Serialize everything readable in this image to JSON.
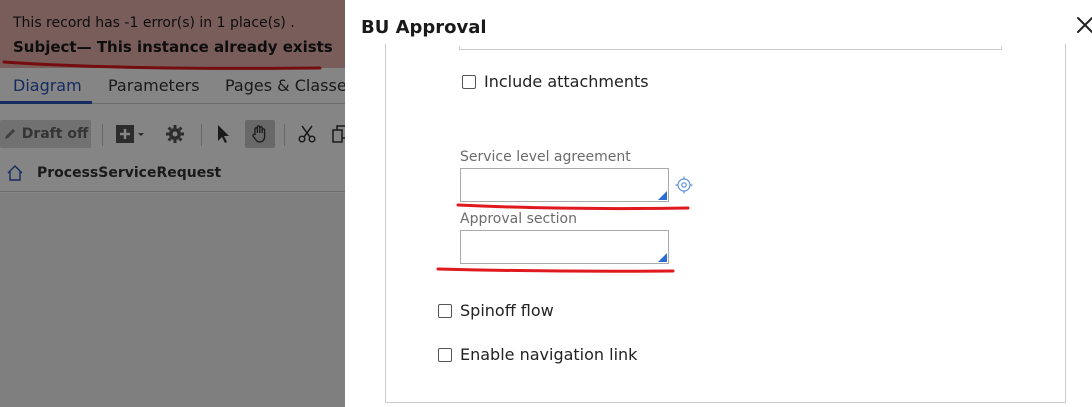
{
  "background": {
    "error_banner": {
      "line1": "This record has -1 error(s) in 1 place(s) .",
      "line2": "Subject— This instance already exists"
    },
    "tabs": [
      {
        "label": "Diagram",
        "active": true
      },
      {
        "label": "Parameters",
        "active": false
      },
      {
        "label": "Pages & Classes",
        "active": false
      }
    ],
    "toolbar": {
      "draft_label": "Draft off"
    },
    "breadcrumb": {
      "label": "ProcessServiceRequest"
    }
  },
  "modal": {
    "title": "BU Approval",
    "include_attachments": {
      "label": "Include attachments",
      "checked": false
    },
    "service_level_agreement": {
      "label": "Service level agreement",
      "value": ""
    },
    "approval_section": {
      "label": "Approval section",
      "value": ""
    },
    "spinoff_flow": {
      "label": "Spinoff flow",
      "checked": false
    },
    "enable_navigation_link": {
      "label": "Enable navigation link",
      "checked": false
    }
  },
  "colors": {
    "error_banner_bg": "#e6b3ad",
    "active_tab": "#2a55b8",
    "annotation_red": "#e0191e",
    "corner_accent": "#2b6cd6"
  }
}
